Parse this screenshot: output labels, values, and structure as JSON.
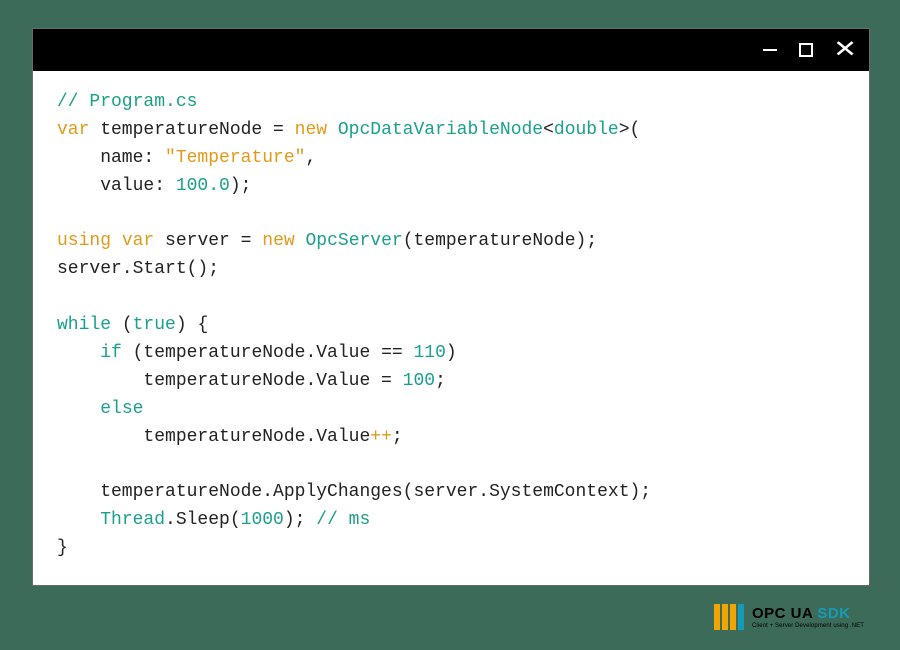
{
  "titlebar": {
    "minimize": "—",
    "maximize": "▢",
    "close": "✕"
  },
  "code": {
    "l1_comment": "// Program.cs",
    "l2_var": "var",
    "l2_ident": " temperatureNode = ",
    "l2_new": "new",
    "l2_sp": " ",
    "l2_class": "OpcDataVariableNode",
    "l2_lt": "<",
    "l2_gtype": "double",
    "l2_gt": ">(",
    "l3_indent": "    name: ",
    "l3_str": "\"Temperature\"",
    "l3_end": ",",
    "l4_indent": "    value: ",
    "l4_num": "100.0",
    "l4_end": ");",
    "blank1": "",
    "l5_using": "using",
    "l5_sp": " ",
    "l5_var": "var",
    "l5_ident": " server = ",
    "l5_new": "new",
    "l5_sp2": " ",
    "l5_class": "OpcServer",
    "l5_args": "(temperatureNode);",
    "l6": "server.Start();",
    "blank2": "",
    "l7_while": "while",
    "l7_sp": " (",
    "l7_true": "true",
    "l7_end": ") {",
    "l8_indent": "    ",
    "l8_if": "if",
    "l8_cond": " (temperatureNode.Value == ",
    "l8_num": "110",
    "l8_end": ")",
    "l9_indent": "        temperatureNode.Value = ",
    "l9_num": "100",
    "l9_end": ";",
    "l10_indent": "    ",
    "l10_else": "else",
    "l11_indent": "        temperatureNode.Value",
    "l11_op": "++",
    "l11_end": ";",
    "blank3": "",
    "l12": "    temperatureNode.ApplyChanges(server.SystemContext);",
    "l13_indent": "    ",
    "l13_class": "Thread",
    "l13_call": ".Sleep(",
    "l13_num": "1000",
    "l13_close": "); ",
    "l13_comment": "// ms",
    "l14": "}"
  },
  "brand": {
    "name_a": "OPC UA",
    "name_b": "SDK",
    "sub": "Client + Server Development using .NET"
  }
}
